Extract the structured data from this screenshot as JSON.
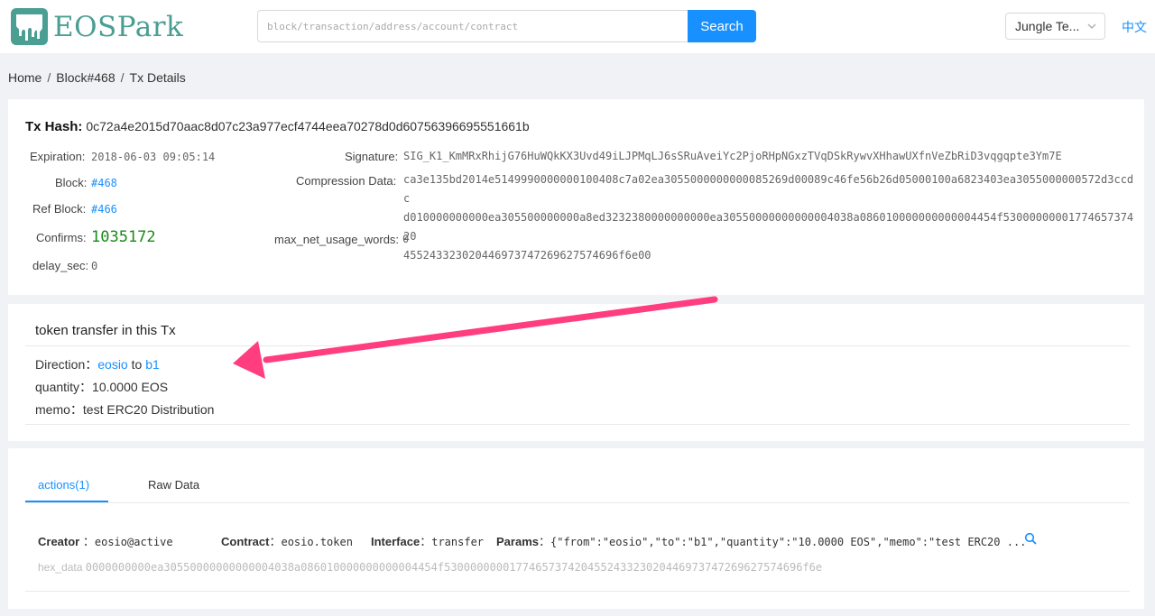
{
  "header": {
    "logo_text": "EOSPark",
    "search_placeholder": "block/transaction/address/account/contract",
    "search_button": "Search",
    "network": "Jungle Te...",
    "language": "中文"
  },
  "breadcrumb": [
    "Home",
    "Block#468",
    "Tx Details"
  ],
  "tx": {
    "hash_label": "Tx Hash:",
    "hash": "0c72a4e2015d70aac8d07c23a977ecf4744eea70278d0d60756396695551661b",
    "expiration_label": "Expiration:",
    "expiration": "2018-06-03 09:05:14",
    "block_label": "Block:",
    "block": "#468",
    "ref_block_label": "Ref Block:",
    "ref_block": "#466",
    "confirms_label": "Confirms:",
    "confirms": "1035172",
    "delay_label": "delay_sec:",
    "delay": "0",
    "signature_label": "Signature:",
    "signature": "SIG_K1_KmMRxRhijG76HuWQkKX3Uvd49iLJPMqLJ6sSRuAveiYc2PjoRHpNGxzTVqDSkRywvXHhawUXfnVeZbRiD3vqgqpte3Ym7E",
    "compression_label": "Compression Data:",
    "compression_lines": [
      "ca3e135bd2014e5149990000000100408c7a02ea3055000000000085269d00089c46fe56b26d05000100a6823403ea3055000000572d3ccdc",
      "d010000000000ea305500000000a8ed3232380000000000ea30550000000000004038a086010000000000004454f5300000000177465737420",
      "455243323020446973747269627574696f6e00"
    ],
    "max_net_label": "max_net_usage_words:",
    "max_net": "0"
  },
  "transfer": {
    "title": "token transfer in this Tx",
    "direction_label": "Direction：",
    "from": "eosio",
    "to_word": "to",
    "to": "b1",
    "quantity_label": "quantity：",
    "quantity": "10.0000 EOS",
    "memo_label": "memo：",
    "memo": "test ERC20 Distribution"
  },
  "tabs": {
    "actions": "actions(1)",
    "raw": "Raw Data"
  },
  "action": {
    "creator_label": "Creator",
    "creator": "eosio@active",
    "contract_label": "Contract",
    "contract": "eosio.token",
    "interface_label": "Interface",
    "interface": "transfer",
    "params_label": "Params",
    "params": "{\"from\":\"eosio\",\"to\":\"b1\",\"quantity\":\"10.0000 EOS\",\"memo\":\"test ERC20 ...",
    "hex_label": "hex_data",
    "hex": "0000000000ea30550000000000004038a086010000000000004454f5300000000177465737420455243323020446973747269627574696f6e"
  },
  "icons": {
    "search": "search-icon",
    "chevron": "chevron-down-icon",
    "logo": "eospark-logo-icon"
  },
  "colors": {
    "primary": "#1890ff",
    "logo": "#4a9e92",
    "confirms": "#1a8a1a",
    "annotation_arrow": "#ff3d7f"
  }
}
